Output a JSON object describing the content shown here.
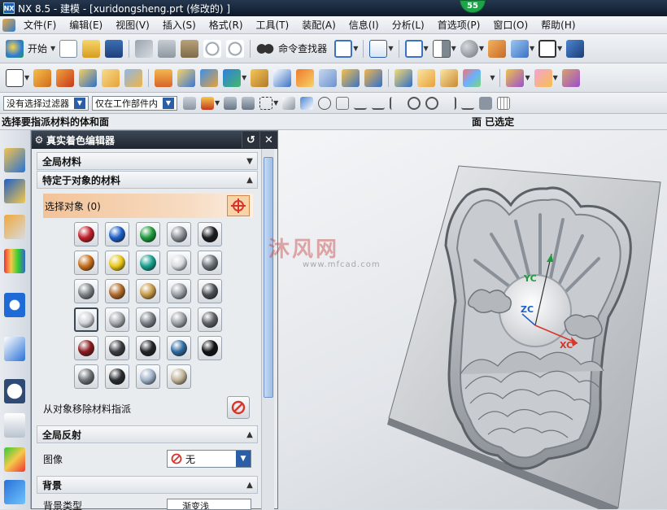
{
  "window": {
    "app_badge": "NX",
    "title": "NX 8.5 - 建模 - [xuridongsheng.prt (修改的) ]",
    "notification_count": "55"
  },
  "menu": [
    "文件(F)",
    "编辑(E)",
    "视图(V)",
    "插入(S)",
    "格式(R)",
    "工具(T)",
    "装配(A)",
    "信息(I)",
    "分析(L)",
    "首选项(P)",
    "窗口(O)",
    "帮助(H)"
  ],
  "toolbar": {
    "start_label": "开始",
    "command_finder_label": "命令查找器"
  },
  "selection_bar": {
    "filter_value": "没有选择过滤器",
    "scope_value": "仅在工作部件内"
  },
  "cue_line": {
    "prompt": "选择要指派材料的体和面",
    "status": "面 已选定"
  },
  "dialog": {
    "title": "真实着色编辑器",
    "sections": {
      "global_material": "全局材料",
      "object_material": "特定于对象的材料",
      "global_reflection": "全局反射",
      "background": "背景"
    },
    "select_object_label": "选择对象 (0)",
    "remove_material_label": "从对象移除材料指派",
    "image_label": "图像",
    "image_value": "无",
    "background_type_label": "背景类型",
    "background_type_value": "渐变浅"
  },
  "materials": [
    [
      "#c0202a",
      "#1e5fc8",
      "#1e9a3c",
      "#8a8f96",
      "#1b1d21"
    ],
    [
      "#c8701c",
      "#e8c61a",
      "#17a08e",
      "#d7dbe0",
      "#6c737b"
    ],
    [
      "#7d8288",
      "#b06a2a",
      "#c89a48",
      "#9aa0a7",
      "#4a4f55"
    ],
    [
      "#cfd3d8",
      "#a4a9af",
      "#7b8087",
      "#9da2a8",
      "#5d6268"
    ],
    [
      "#8a1a1e",
      "#3a3d42",
      "#222428",
      "#2f6aa0",
      "#101113"
    ],
    [
      "#6e7379",
      "#2a2c30",
      "#9fb2c8",
      "#c2b49a"
    ]
  ],
  "viewport": {
    "axis_yc": "YC",
    "axis_zc": "ZC",
    "axis_xc": "XC",
    "watermark": "沐风网",
    "watermark_url": "www.mfcad.com"
  }
}
